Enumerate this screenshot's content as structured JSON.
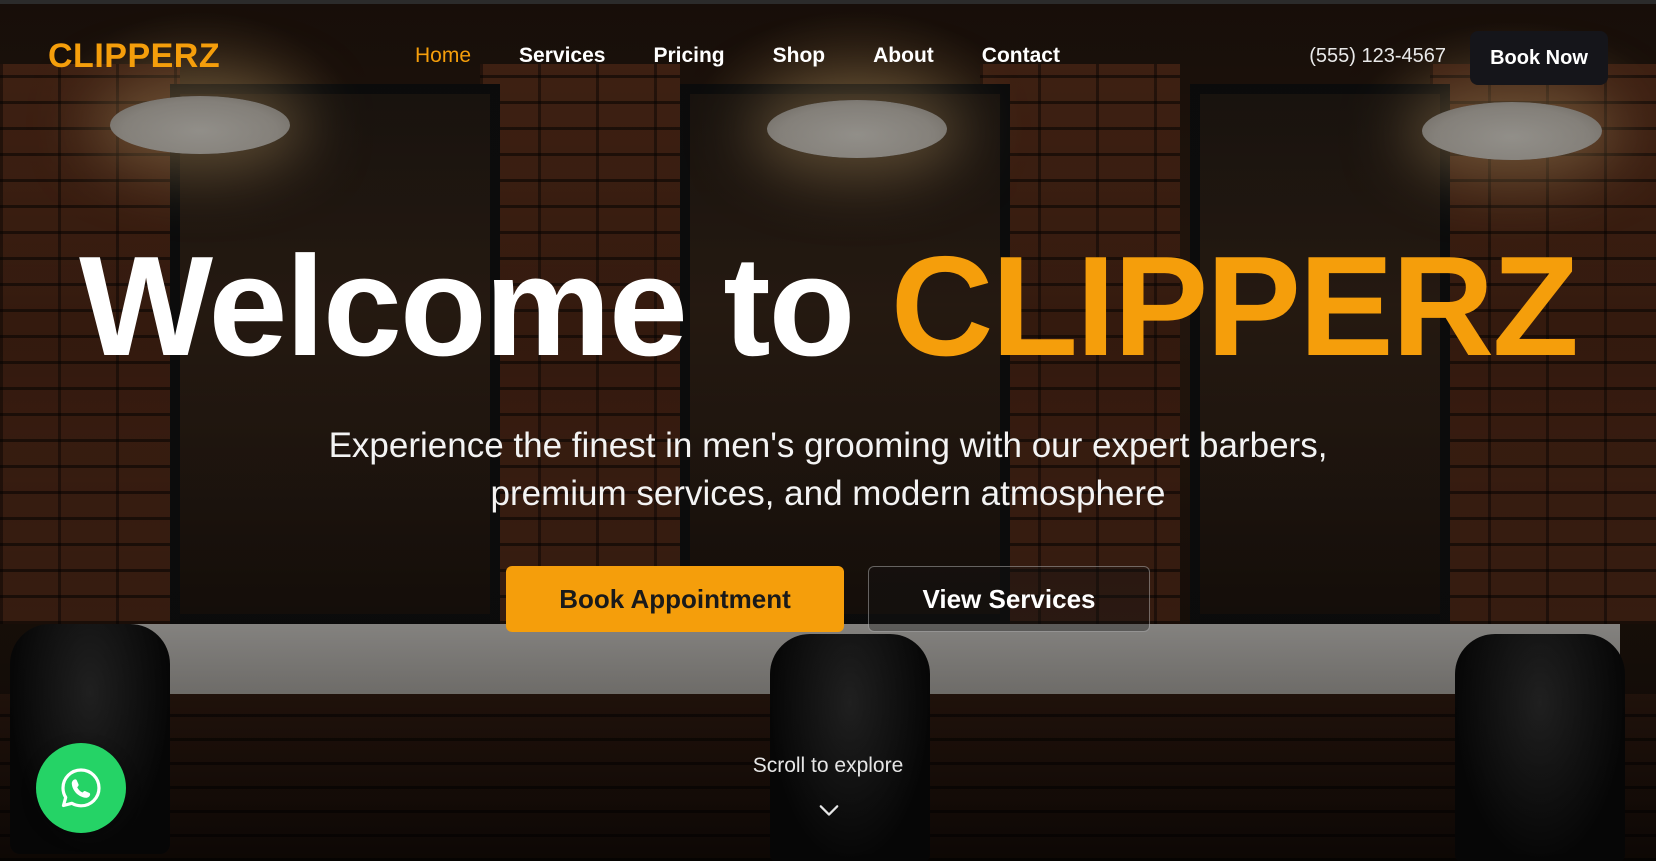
{
  "brand": {
    "logo": "CLIPPERZ",
    "accent_color": "#f59e0b"
  },
  "nav": {
    "items": [
      {
        "label": "Home",
        "active": true
      },
      {
        "label": "Services",
        "active": false
      },
      {
        "label": "Pricing",
        "active": false
      },
      {
        "label": "Shop",
        "active": false
      },
      {
        "label": "About",
        "active": false
      },
      {
        "label": "Contact",
        "active": false
      }
    ],
    "phone": "(555) 123-4567",
    "cta_label": "Book Now"
  },
  "hero": {
    "title_prefix": "Welcome to",
    "title_accent": "CLIPPERZ",
    "subtitle_line1": "Experience the finest in men's grooming with our expert barbers,",
    "subtitle_line2": "premium services, and modern atmosphere",
    "primary_button": "Book Appointment",
    "secondary_button": "View Services",
    "scroll_hint": "Scroll to explore"
  },
  "floating": {
    "whatsapp_icon": "whatsapp-icon",
    "whatsapp_color": "#25d366"
  }
}
